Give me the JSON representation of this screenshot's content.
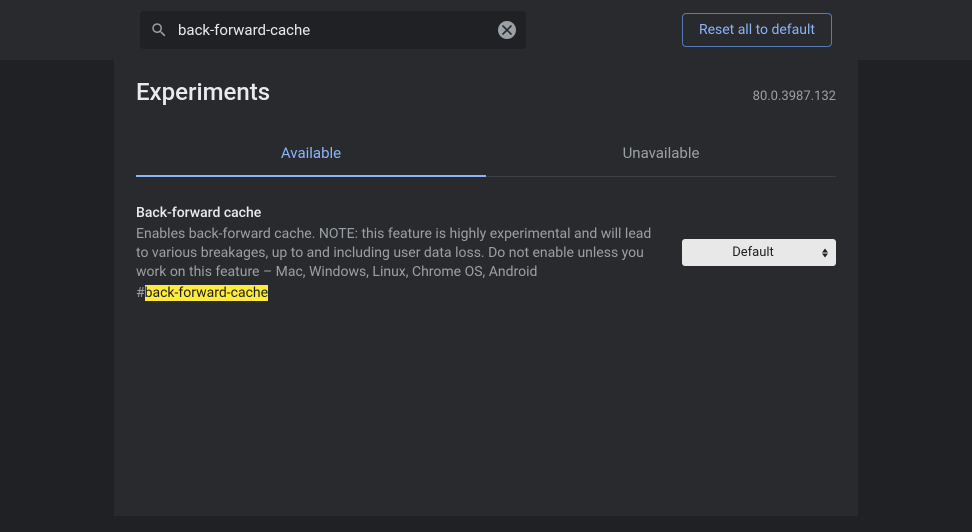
{
  "search": {
    "value": "back-forward-cache"
  },
  "reset_label": "Reset all to default",
  "page_title": "Experiments",
  "version": "80.0.3987.132",
  "tabs": {
    "available": "Available",
    "unavailable": "Unavailable"
  },
  "flag": {
    "title": "Back-forward cache",
    "description": "Enables back-forward cache. NOTE: this feature is highly experimental and will lead to various breakages, up to and including user data loss. Do not enable unless you work on this feature – Mac, Windows, Linux, Chrome OS, Android",
    "hash_prefix": "#",
    "hash_highlight": "back-forward-cache",
    "select_value": "Default"
  }
}
